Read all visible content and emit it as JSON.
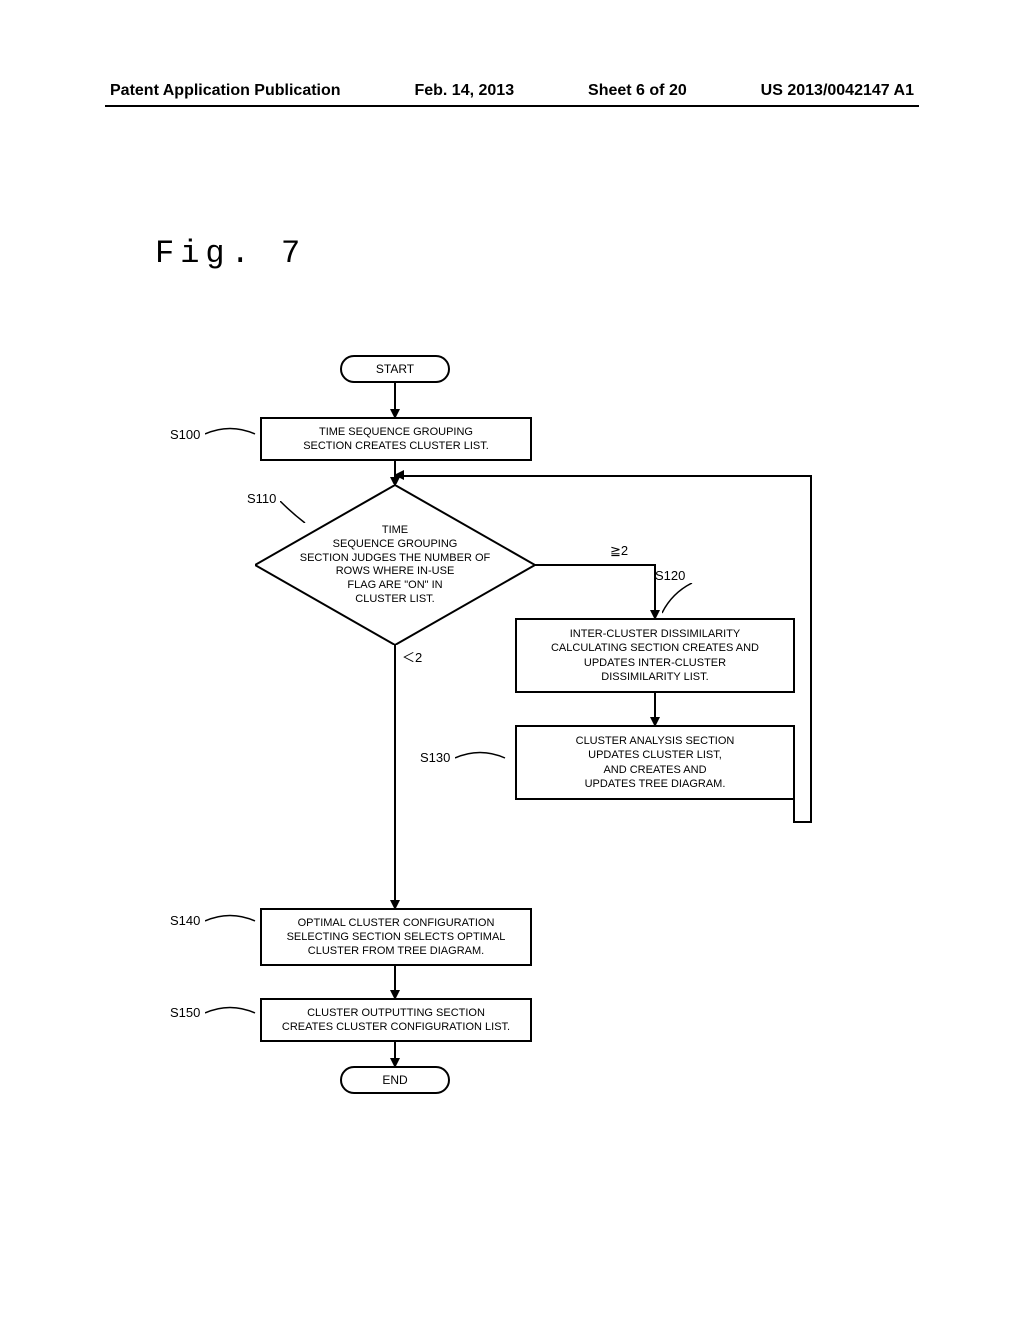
{
  "header": {
    "pub_type": "Patent Application Publication",
    "date": "Feb. 14, 2013",
    "sheet": "Sheet 6 of 20",
    "pub_number": "US 2013/0042147 A1"
  },
  "figure_label": "Fig. 7",
  "flow": {
    "start": "START",
    "end": "END",
    "s100": {
      "label": "S100",
      "text": "TIME SEQUENCE GROUPING\nSECTION CREATES CLUSTER LIST."
    },
    "s110": {
      "label": "S110",
      "text": "TIME\nSEQUENCE GROUPING\nSECTION JUDGES THE NUMBER OF\nROWS WHERE IN-USE\nFLAG ARE \"ON\" IN\nCLUSTER LIST.",
      "cond_ge": "≧2",
      "cond_lt": "＜2"
    },
    "s120": {
      "label": "S120",
      "text": "INTER-CLUSTER DISSIMILARITY\nCALCULATING SECTION CREATES AND\nUPDATES INTER-CLUSTER\nDISSIMILARITY LIST."
    },
    "s130": {
      "label": "S130",
      "text": "CLUSTER ANALYSIS SECTION\nUPDATES CLUSTER LIST,\nAND CREATES AND\nUPDATES TREE DIAGRAM."
    },
    "s140": {
      "label": "S140",
      "text": "OPTIMAL CLUSTER CONFIGURATION\nSELECTING SECTION SELECTS OPTIMAL\nCLUSTER FROM TREE DIAGRAM."
    },
    "s150": {
      "label": "S150",
      "text": "CLUSTER OUTPUTTING SECTION\nCREATES CLUSTER CONFIGURATION LIST."
    }
  }
}
